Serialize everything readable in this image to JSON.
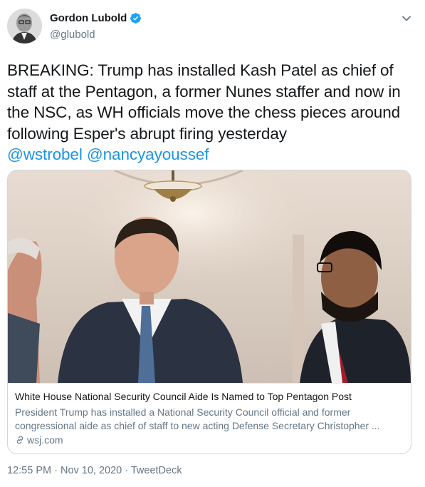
{
  "author": {
    "display_name": "Gordon Lubold",
    "handle": "@glubold",
    "verified": true
  },
  "tweet": {
    "text": "BREAKING: Trump has installed Kash Patel as chief of staff at the Pentagon, a former Nunes staffer and now in the NSC, as WH officials move the chess pieces around following Esper's abrupt firing yesterday",
    "mentions": [
      "@wstrobel",
      "@nancyayoussef"
    ]
  },
  "card": {
    "title": "White House National Security Council Aide Is Named to Top Pentagon Post",
    "description": "President Trump has installed a National Security Council official and former congressional aide as chief of staff to new acting Defense Secretary Christopher ...",
    "domain": "wsj.com"
  },
  "meta": {
    "time": "12:55 PM",
    "date": "Nov 10, 2020",
    "source": "TweetDeck",
    "separator": " · "
  },
  "colors": {
    "link": "#1b95e0",
    "secondary_text": "#657786",
    "border": "#ccd6dd",
    "verified_badge": "#1da1f2"
  },
  "icons": {
    "menu": "chevron-down-icon",
    "verified": "verified-badge-icon",
    "link": "link-icon"
  }
}
